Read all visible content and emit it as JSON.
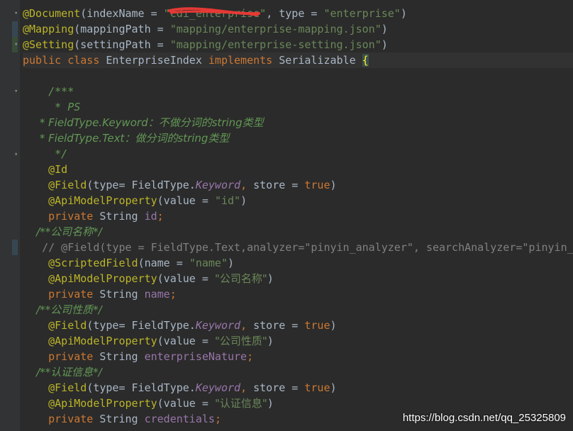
{
  "colors": {
    "background": "#2b2b2b",
    "gutter": "#313335",
    "keyword": "#cc7832",
    "annotation": "#bbb529",
    "string": "#6a8759",
    "field": "#9876aa",
    "doc_comment": "#629755",
    "line_comment": "#808080",
    "default_text": "#a9b7c6",
    "redaction": "#e53935"
  },
  "icons": {
    "fold_marker": "fold-caret-icon",
    "redaction": "red-scribble-icon"
  },
  "code": [
    {
      "role": "doc-annotation",
      "tokens": [
        {
          "t": "ann",
          "v": "@Document"
        },
        {
          "t": "plain",
          "v": "(indexName = "
        },
        {
          "t": "str",
          "v": "\"cdi_enterprise\""
        },
        {
          "t": "plain",
          "v": ", type = "
        },
        {
          "t": "str",
          "v": "\"enterprise\""
        },
        {
          "t": "plain",
          "v": ")"
        }
      ]
    },
    {
      "role": "mapping-annotation",
      "tokens": [
        {
          "t": "ann",
          "v": "@Mapping"
        },
        {
          "t": "plain",
          "v": "(mappingPath = "
        },
        {
          "t": "str",
          "v": "\"mapping/enterprise-mapping.json\""
        },
        {
          "t": "plain",
          "v": ")"
        }
      ]
    },
    {
      "role": "setting-annotation",
      "tokens": [
        {
          "t": "ann",
          "v": "@Setting"
        },
        {
          "t": "plain",
          "v": "(settingPath = "
        },
        {
          "t": "str",
          "v": "\"mapping/enterprise-setting.json\""
        },
        {
          "t": "plain",
          "v": ")"
        }
      ]
    },
    {
      "role": "class-declaration",
      "tokens": [
        {
          "t": "kw",
          "v": "public class "
        },
        {
          "t": "plain",
          "v": "EnterpriseIndex "
        },
        {
          "t": "kw",
          "v": "implements "
        },
        {
          "t": "plain",
          "v": "Serializable "
        },
        {
          "t": "brace",
          "v": "{"
        }
      ]
    },
    {
      "role": "blank",
      "tokens": []
    },
    {
      "role": "doc-comment",
      "tokens": [
        {
          "t": "com",
          "v": "    /***"
        }
      ]
    },
    {
      "role": "doc-comment",
      "tokens": [
        {
          "t": "com",
          "v": "     * PS"
        }
      ]
    },
    {
      "role": "doc-comment",
      "tokens": [
        {
          "t": "com",
          "v": "     * FieldType.Keyword：不做分词的string类型"
        }
      ]
    },
    {
      "role": "doc-comment",
      "tokens": [
        {
          "t": "com",
          "v": "     * FieldType.Text：做分词的string类型"
        }
      ]
    },
    {
      "role": "doc-comment",
      "tokens": [
        {
          "t": "com",
          "v": "     */"
        }
      ]
    },
    {
      "role": "annotation",
      "tokens": [
        {
          "t": "plain",
          "v": "    "
        },
        {
          "t": "ann",
          "v": "@Id"
        }
      ]
    },
    {
      "role": "annotation",
      "tokens": [
        {
          "t": "plain",
          "v": "    "
        },
        {
          "t": "ann",
          "v": "@Field"
        },
        {
          "t": "plain",
          "v": "(type= FieldType."
        },
        {
          "t": "ital",
          "v": "Keyword"
        },
        {
          "t": "kw",
          "v": ", "
        },
        {
          "t": "plain",
          "v": "store = "
        },
        {
          "t": "kw",
          "v": "true"
        },
        {
          "t": "plain",
          "v": ")"
        }
      ]
    },
    {
      "role": "annotation",
      "tokens": [
        {
          "t": "plain",
          "v": "    "
        },
        {
          "t": "ann",
          "v": "@ApiModelProperty"
        },
        {
          "t": "plain",
          "v": "(value = "
        },
        {
          "t": "str",
          "v": "\"id\""
        },
        {
          "t": "plain",
          "v": ")"
        }
      ]
    },
    {
      "role": "field-declaration",
      "tokens": [
        {
          "t": "plain",
          "v": "    "
        },
        {
          "t": "kw",
          "v": "private "
        },
        {
          "t": "plain",
          "v": "String "
        },
        {
          "t": "field",
          "v": "id"
        },
        {
          "t": "kw",
          "v": ";"
        }
      ]
    },
    {
      "role": "doc-comment",
      "tokens": [
        {
          "t": "com",
          "v": "    /**公司名称*/"
        }
      ]
    },
    {
      "role": "line-comment",
      "tokens": [
        {
          "t": "linecom",
          "v": "   // @Field(type = FieldType.Text,analyzer=\"pinyin_analyzer\", searchAnalyzer=\"pinyin_analyzer\")"
        }
      ]
    },
    {
      "role": "annotation",
      "tokens": [
        {
          "t": "plain",
          "v": "    "
        },
        {
          "t": "ann",
          "v": "@ScriptedField"
        },
        {
          "t": "plain",
          "v": "(name = "
        },
        {
          "t": "str",
          "v": "\"name\""
        },
        {
          "t": "plain",
          "v": ")"
        }
      ]
    },
    {
      "role": "annotation",
      "tokens": [
        {
          "t": "plain",
          "v": "    "
        },
        {
          "t": "ann",
          "v": "@ApiModelProperty"
        },
        {
          "t": "plain",
          "v": "(value = "
        },
        {
          "t": "str",
          "v": "\"公司名称\""
        },
        {
          "t": "plain",
          "v": ")"
        }
      ]
    },
    {
      "role": "field-declaration",
      "tokens": [
        {
          "t": "plain",
          "v": "    "
        },
        {
          "t": "kw",
          "v": "private "
        },
        {
          "t": "plain",
          "v": "String "
        },
        {
          "t": "field",
          "v": "name"
        },
        {
          "t": "kw",
          "v": ";"
        }
      ]
    },
    {
      "role": "doc-comment",
      "tokens": [
        {
          "t": "com",
          "v": "    /**公司性质*/"
        }
      ]
    },
    {
      "role": "annotation",
      "tokens": [
        {
          "t": "plain",
          "v": "    "
        },
        {
          "t": "ann",
          "v": "@Field"
        },
        {
          "t": "plain",
          "v": "(type= FieldType."
        },
        {
          "t": "ital",
          "v": "Keyword"
        },
        {
          "t": "kw",
          "v": ", "
        },
        {
          "t": "plain",
          "v": "store = "
        },
        {
          "t": "kw",
          "v": "true"
        },
        {
          "t": "plain",
          "v": ")"
        }
      ]
    },
    {
      "role": "annotation",
      "tokens": [
        {
          "t": "plain",
          "v": "    "
        },
        {
          "t": "ann",
          "v": "@ApiModelProperty"
        },
        {
          "t": "plain",
          "v": "(value = "
        },
        {
          "t": "str",
          "v": "\"公司性质\""
        },
        {
          "t": "plain",
          "v": ")"
        }
      ]
    },
    {
      "role": "field-declaration",
      "tokens": [
        {
          "t": "plain",
          "v": "    "
        },
        {
          "t": "kw",
          "v": "private "
        },
        {
          "t": "plain",
          "v": "String "
        },
        {
          "t": "field",
          "v": "enterpriseNature"
        },
        {
          "t": "kw",
          "v": ";"
        }
      ]
    },
    {
      "role": "doc-comment",
      "tokens": [
        {
          "t": "com",
          "v": "    /**认证信息*/"
        }
      ]
    },
    {
      "role": "annotation",
      "tokens": [
        {
          "t": "plain",
          "v": "    "
        },
        {
          "t": "ann",
          "v": "@Field"
        },
        {
          "t": "plain",
          "v": "(type= FieldType."
        },
        {
          "t": "ital",
          "v": "Keyword"
        },
        {
          "t": "kw",
          "v": ", "
        },
        {
          "t": "plain",
          "v": "store = "
        },
        {
          "t": "kw",
          "v": "true"
        },
        {
          "t": "plain",
          "v": ")"
        }
      ]
    },
    {
      "role": "annotation",
      "tokens": [
        {
          "t": "plain",
          "v": "    "
        },
        {
          "t": "ann",
          "v": "@ApiModelProperty"
        },
        {
          "t": "plain",
          "v": "(value = "
        },
        {
          "t": "str",
          "v": "\"认证信息\""
        },
        {
          "t": "plain",
          "v": ")"
        }
      ]
    },
    {
      "role": "field-declaration",
      "tokens": [
        {
          "t": "plain",
          "v": "    "
        },
        {
          "t": "kw",
          "v": "private "
        },
        {
          "t": "plain",
          "v": "String "
        },
        {
          "t": "field",
          "v": "credentials"
        },
        {
          "t": "kw",
          "v": ";"
        }
      ]
    }
  ],
  "watermark": "https://blog.csdn.net/qq_25325809"
}
